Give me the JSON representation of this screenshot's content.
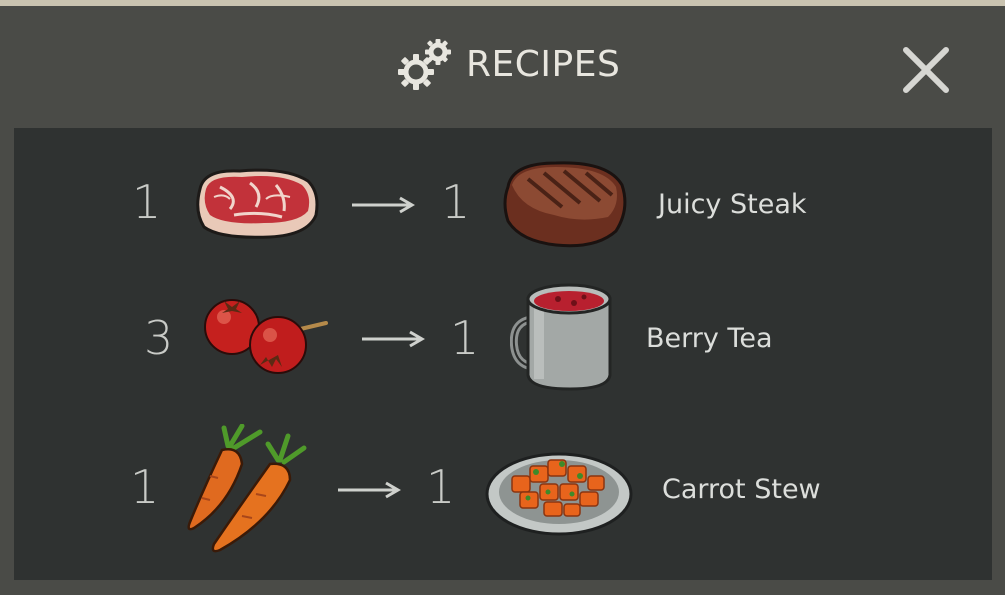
{
  "window": {
    "title": "RECIPES",
    "title_icon": "gears-icon",
    "close_icon": "close-icon"
  },
  "recipes": [
    {
      "input_qty": "1",
      "input_icon": "raw-meat-icon",
      "output_qty": "1",
      "output_icon": "cooked-steak-icon",
      "output_name": "Juicy Steak"
    },
    {
      "input_qty": "3",
      "input_icon": "berries-icon",
      "output_qty": "1",
      "output_icon": "tea-mug-icon",
      "output_name": "Berry Tea"
    },
    {
      "input_qty": "1",
      "input_icon": "carrots-icon",
      "output_qty": "1",
      "output_icon": "stew-plate-icon",
      "output_name": "Carrot Stew"
    }
  ],
  "colors": {
    "header_bg": "#4a4b47",
    "panel_bg": "#2f3231",
    "text": "#dcdedb"
  }
}
